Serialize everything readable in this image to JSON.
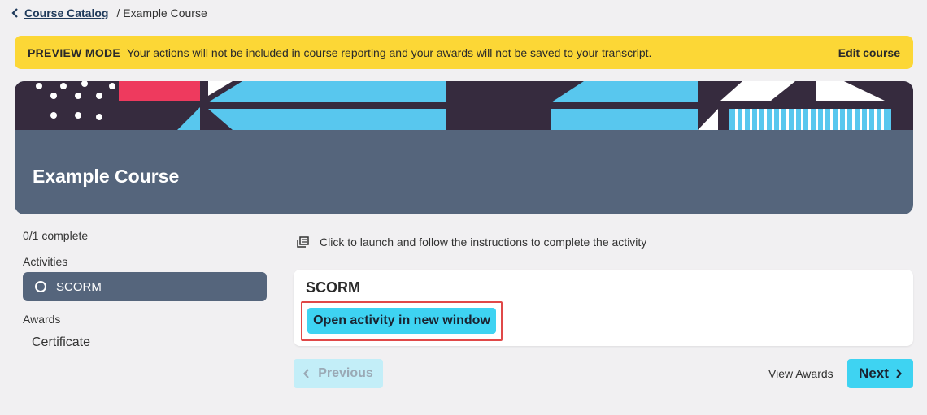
{
  "breadcrumb": {
    "parent": "Course Catalog",
    "current": "/ Example Course"
  },
  "banner": {
    "tag": "PREVIEW MODE",
    "message": "Your actions will not be included in course reporting and your awards will not be saved to your transcript.",
    "action": "Edit course",
    "color": "#fcd736"
  },
  "hero": {
    "title": "Example Course",
    "bg_color": "#55657c"
  },
  "sidebar": {
    "progress": "0/1 complete",
    "activities_label": "Activities",
    "activities": [
      {
        "label": "SCORM",
        "icon": "circle-outline-icon"
      }
    ],
    "awards_label": "Awards",
    "awards": [
      {
        "label": "Certificate"
      }
    ]
  },
  "main": {
    "instruction": "Click to launch and follow the instructions to complete the activity",
    "instruction_icon": "copy-icon",
    "card": {
      "title": "SCORM",
      "open_button": "Open activity in new window"
    }
  },
  "footer": {
    "previous": "Previous",
    "view_awards": "View Awards",
    "next": "Next",
    "accent": "#3ed3f2"
  }
}
